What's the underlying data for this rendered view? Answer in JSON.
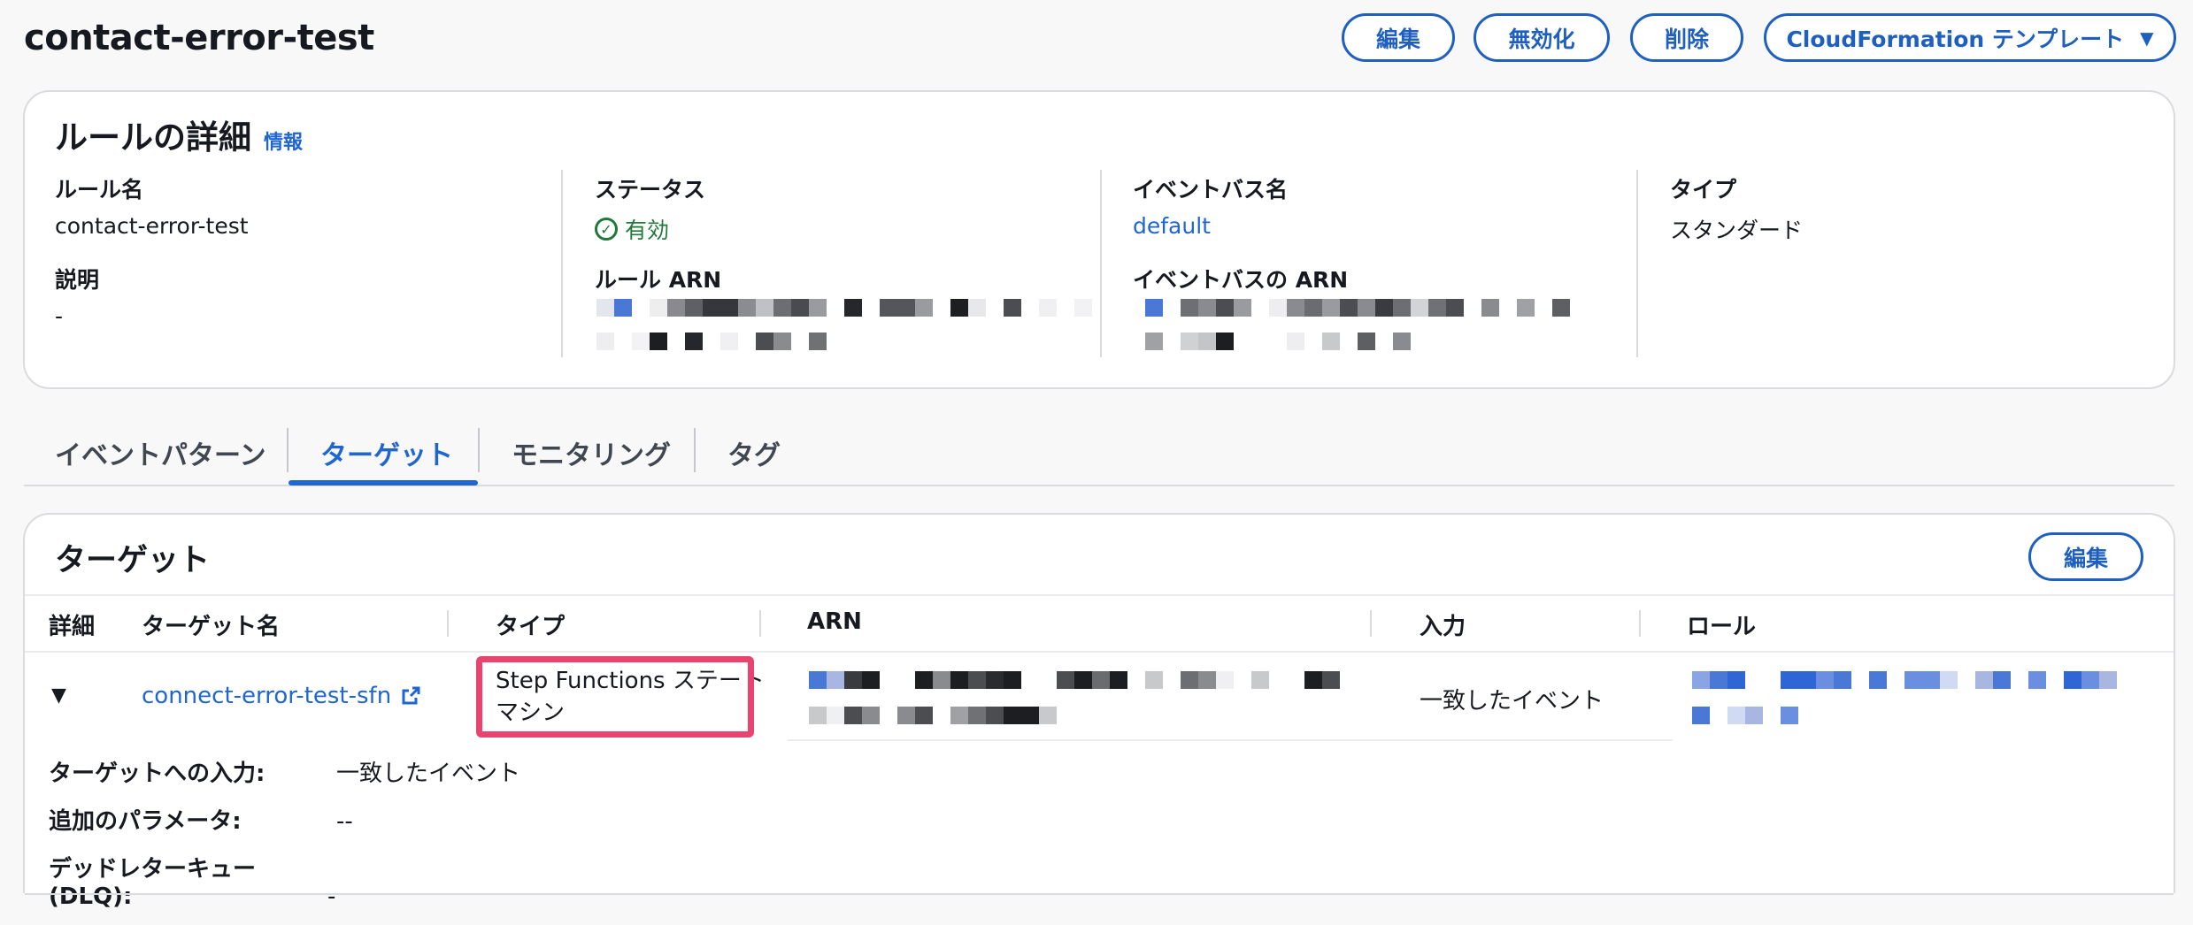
{
  "header": {
    "title": "contact-error-test",
    "buttons": {
      "edit": "編集",
      "disable": "無効化",
      "delete": "削除",
      "cloudformation": "CloudFormation テンプレート"
    }
  },
  "rule_details": {
    "title": "ルールの詳細",
    "info": "情報",
    "rule_name_label": "ルール名",
    "rule_name_value": "contact-error-test",
    "description_label": "説明",
    "description_value": "-",
    "status_label": "ステータス",
    "status_value": "有効",
    "rule_arn_label": "ルール ARN",
    "event_bus_label": "イベントバス名",
    "event_bus_value": "default",
    "event_bus_arn_label": "イベントバスの ARN",
    "type_label": "タイプ",
    "type_value": "スタンダード"
  },
  "tabs": {
    "event_pattern": "イベントパターン",
    "target": "ターゲット",
    "monitoring": "モニタリング",
    "tags": "タグ"
  },
  "targets": {
    "title": "ターゲット",
    "edit": "編集",
    "columns": {
      "detail": "詳細",
      "target_name": "ターゲット名",
      "type": "タイプ",
      "arn": "ARN",
      "input": "入力",
      "role": "ロール"
    },
    "row": {
      "target_name": "connect-error-test-sfn",
      "type_line1": "Step Functions ステート",
      "type_line2": "マシン",
      "input": "一致したイベント"
    },
    "details": {
      "input_label": "ターゲットへの入力:",
      "input_value": "一致したイベント",
      "params_label": "追加のパラメータ:",
      "params_value": "--",
      "dlq_label": "デッドレターキュー (DLQ):",
      "dlq_value": "-"
    }
  },
  "colors": {
    "accent": "#1f66d1",
    "success": "#1f7a3a",
    "highlight": "#e8446f"
  }
}
